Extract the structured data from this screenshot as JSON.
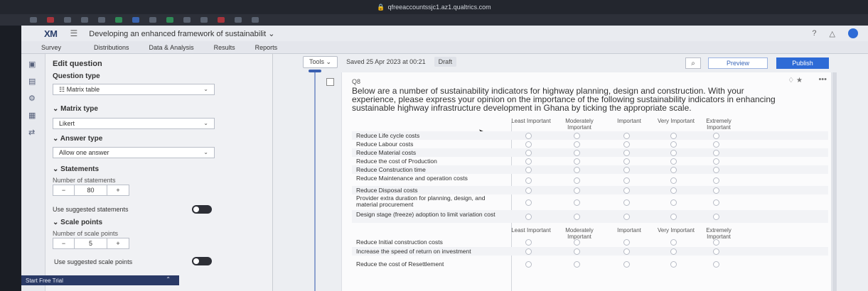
{
  "browser": {
    "url": "qfreeaccountssjc1.az1.qualtrics.com"
  },
  "header": {
    "logo": "XM",
    "project_title": "Developing an enhanced framework of sustainabilit ⌄",
    "help_icon": "?",
    "bell_icon": "△"
  },
  "nav": {
    "tabs": [
      "Survey",
      "Distributions",
      "Data & Analysis",
      "Results",
      "Reports"
    ]
  },
  "panel": {
    "title": "Edit question",
    "question_type_label": "Question type",
    "question_type_value": "☷ Matrix table",
    "matrix_type_label": "⌄ Matrix type",
    "matrix_type_value": "Likert",
    "answer_type_label": "⌄ Answer type",
    "answer_type_value": "Allow one answer",
    "statements_label": "⌄ Statements",
    "num_statements_label": "Number of statements",
    "num_statements_value": "80",
    "minus": "−",
    "plus": "+",
    "use_suggested_statements": "Use suggested statements",
    "scale_points_label": "⌄ Scale points",
    "num_scale_label": "Number of scale points",
    "num_scale_value": "5",
    "use_suggested_scale": "Use suggested scale points",
    "trial": "Start Free Trial",
    "trial_chevron": "⌃"
  },
  "toolbar": {
    "tools": "Tools ⌄",
    "saved": "Saved 25 Apr 2023 at 00:21",
    "draft": "Draft",
    "search": "⌕",
    "preview": "Preview",
    "publish": "Publish"
  },
  "question": {
    "id": "Q8",
    "actions": "♢  ★",
    "more": "•••",
    "text": "Below are a number of sustainability indicators for highway planning, design and construction. With your experience, please express your opinion on the importance of the following sustainability indicators in enhancing sustainable highway infrastructure development in Ghana by ticking the appropriate scale.",
    "scale": [
      "Least Important",
      "Moderately Important",
      "Important",
      "Very Important",
      "Extremely Important"
    ],
    "statements": [
      "Reduce Life cycle costs",
      "Reduce Labour costs",
      "Reduce Material costs",
      "Reduce the cost of Production",
      "Reduce Construction time",
      "Reduce Maintenance and operation costs",
      "Reduce Disposal costs",
      "Provider extra duration for planning, design, and material procurement",
      "Design stage (freeze) adoption to limit variation cost",
      "Reduce Initial construction costs",
      "Increase the speed of return on investment",
      "Reduce the cost of Resettlement"
    ]
  },
  "colors": {
    "accent": "#2e6bd6",
    "trial_bg": "#2a3a66"
  }
}
